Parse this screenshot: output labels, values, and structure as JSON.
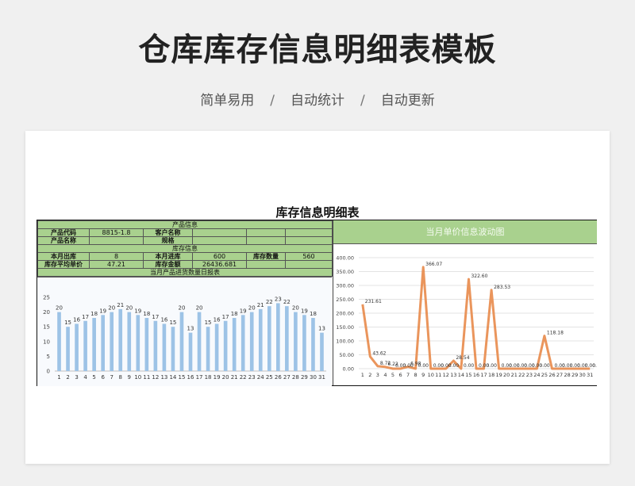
{
  "header": {
    "title": "仓库库存信息明细表模板",
    "tags": [
      "简单易用",
      "自动统计",
      "自动更新"
    ],
    "separator": "/"
  },
  "sheet": {
    "title": "库存信息明细表",
    "section_product": "产品信息",
    "section_stock": "库存信息",
    "product_code_label": "产品代码",
    "product_code_value": "8815-1.8",
    "customer_name_label": "客户名称",
    "product_name_label": "产品名称",
    "spec_label": "规格",
    "month_out_label": "本月出库",
    "month_out_value": "8",
    "month_in_label": "本月进库",
    "month_in_value": "600",
    "stock_qty_label": "库存数量",
    "stock_qty_value": "560",
    "avg_price_label": "库存平均单价",
    "avg_price_value": "47.21",
    "stock_amount_label": "库存金额",
    "stock_amount_value": "26436.681",
    "bar_chart_header": "当月产品进货数量日报表",
    "line_chart_header": "当月单价信息波动图"
  },
  "chart_data": [
    {
      "type": "bar",
      "title": "当月产品进货数量日报表",
      "categories": [
        "1",
        "2",
        "3",
        "4",
        "5",
        "6",
        "7",
        "8",
        "9",
        "10",
        "11",
        "12",
        "13",
        "14",
        "15",
        "16",
        "17",
        "18",
        "19",
        "20",
        "21",
        "22",
        "23",
        "24",
        "25",
        "26",
        "27",
        "28",
        "29",
        "30",
        "31"
      ],
      "values": [
        20,
        15,
        16,
        17,
        18,
        19,
        20,
        21,
        20,
        19,
        18,
        17,
        16,
        15,
        20,
        13,
        20,
        15,
        16,
        17,
        18,
        19,
        20,
        21,
        22,
        23,
        22,
        20,
        19,
        18,
        13
      ],
      "ylim": [
        0,
        25
      ],
      "yticks": [
        0,
        5,
        10,
        15,
        20,
        25
      ],
      "color": "#9dc3e6"
    },
    {
      "type": "line",
      "title": "当月单价信息波动图",
      "categories": [
        "1",
        "2",
        "3",
        "4",
        "5",
        "6",
        "7",
        "8",
        "9",
        "10",
        "11",
        "12",
        "13",
        "14",
        "15",
        "16",
        "17",
        "18",
        "19",
        "20",
        "21",
        "22",
        "23",
        "24",
        "25",
        "26",
        "27",
        "28",
        "29",
        "30",
        "31"
      ],
      "values": [
        231.61,
        43.62,
        8.72,
        6.22,
        0.0,
        0.0,
        6.98,
        0.0,
        366.07,
        0.0,
        0.0,
        0.0,
        28.54,
        0.0,
        322.6,
        0.0,
        0.0,
        283.53,
        0.0,
        0.0,
        0.0,
        0.0,
        0.0,
        0.0,
        118.18,
        0.0,
        0.0,
        0.0,
        0.0,
        0.0,
        0.0
      ],
      "labels": [
        "231.61",
        "43.62",
        "8.72",
        "6.22",
        "0.00",
        "0.00",
        "6.98",
        "0.00",
        "366.07",
        "0.00",
        "0.00",
        "0.00",
        "28.54",
        "0.00",
        "322.60",
        "0.00",
        "0.00",
        "283.53",
        "0.00",
        "0.00",
        "0.00",
        "0.00",
        "0.00",
        "0.00",
        "118.18",
        "0.00",
        "0.00",
        "0.00",
        "0.00",
        "0.00",
        "0.00"
      ],
      "ylim": [
        0,
        400
      ],
      "yticks": [
        "0.00",
        "50.00",
        "100.00",
        "150.00",
        "200.00",
        "250.00",
        "300.00",
        "350.00",
        "400.00"
      ],
      "color": "#e8894a",
      "grid": true
    }
  ]
}
